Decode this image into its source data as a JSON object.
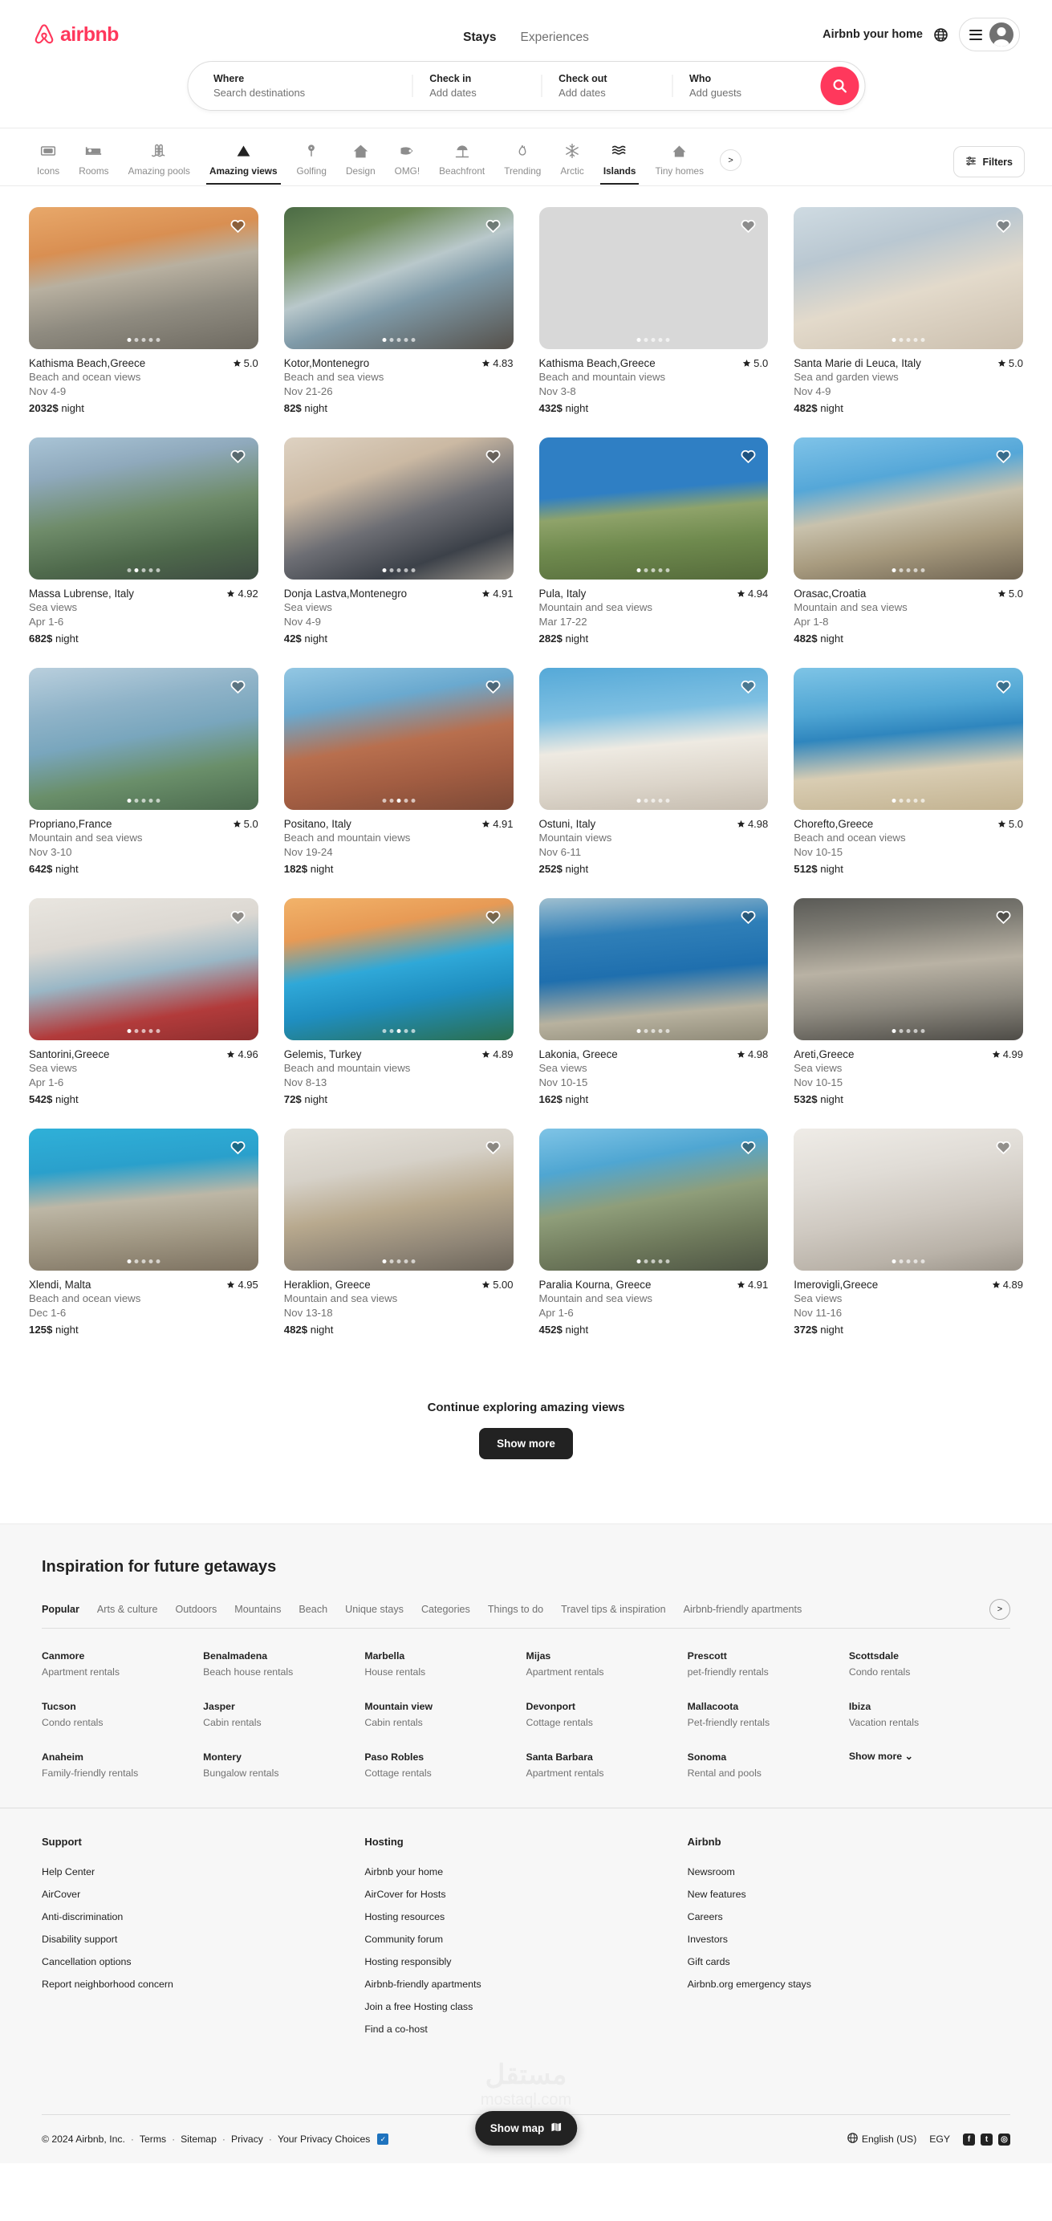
{
  "brand": {
    "name": "airbnb",
    "accent": "#FF385C"
  },
  "header": {
    "tabs": [
      {
        "label": "Stays",
        "active": true
      },
      {
        "label": "Experiences",
        "active": false
      }
    ],
    "host_link": "Airbnb your home",
    "globe_icon": "globe-icon",
    "menu_icon": "hamburger-icon",
    "avatar_icon": "user-avatar-icon"
  },
  "search": {
    "where_label": "Where",
    "where_placeholder": "Search destinations",
    "checkin_label": "Check in",
    "checkin_value": "Add dates",
    "checkout_label": "Check out",
    "checkout_value": "Add dates",
    "who_label": "Who",
    "who_value": "Add guests",
    "search_icon": "search-icon"
  },
  "categories": [
    {
      "label": "Icons",
      "icon": "icons-frame-icon",
      "active": false
    },
    {
      "label": "Rooms",
      "icon": "bed-icon",
      "active": false
    },
    {
      "label": "Amazing pools",
      "icon": "pool-icon",
      "active": false
    },
    {
      "label": "Amazing views",
      "icon": "mountain-icon",
      "active": true
    },
    {
      "label": "Golfing",
      "icon": "golf-icon",
      "active": false
    },
    {
      "label": "Design",
      "icon": "house-icon",
      "active": false
    },
    {
      "label": "OMG!",
      "icon": "omg-icon",
      "active": false
    },
    {
      "label": "Beachfront",
      "icon": "beach-umbrella-icon",
      "active": false
    },
    {
      "label": "Trending",
      "icon": "flame-icon",
      "active": false
    },
    {
      "label": "Arctic",
      "icon": "snowflake-icon",
      "active": false
    },
    {
      "label": "Islands",
      "icon": "waves-icon",
      "active": false
    },
    {
      "label": "Tiny homes",
      "icon": "tiny-house-icon",
      "active": false
    }
  ],
  "catbar": {
    "next_label": ">",
    "filters_label": "Filters",
    "filters_icon": "sliders-icon"
  },
  "listings": [
    {
      "title": "Kathisma Beach,Greece",
      "rating": "5.0",
      "sub": "Beach and ocean views",
      "dates": "Nov 4-9",
      "price": "2032$",
      "per": "night",
      "dots": 5,
      "active_dot": 0,
      "grad": "linear-gradient(170deg,#e8a86a 0%,#d98f52 28%,#b8b0a0 46%,#8f8b80 70%,#6e6a61 100%)"
    },
    {
      "title": "Kotor,Montenegro",
      "rating": "4.83",
      "sub": "Beach and sea views",
      "dates": "Nov 21-26",
      "price": "82$",
      "per": "night",
      "dots": 5,
      "active_dot": 0,
      "grad": "linear-gradient(160deg,#4b6b45 0%,#6d8a58 22%,#b9c8cb 46%,#7f9aa8 62%,#55504a 100%)"
    },
    {
      "title": "Kathisma Beach,Greece",
      "rating": "5.0",
      "sub": "Beach and mountain views",
      "dates": "Nov 3-8",
      "price": "432$",
      "per": "night",
      "dots": 5,
      "active_dot": 0,
      "grad": "linear-gradient(160deg,#c9d6dd 0%,#aebcc5 25%,#e7e0d4 55%,#cfc3b2 80%,#8f8madd 100%)"
    },
    {
      "title": "Santa Marie di Leuca, Italy",
      "rating": "5.0",
      "sub": "Sea and garden views",
      "dates": "Nov 4-9",
      "price": "482$",
      "per": "night",
      "dots": 5,
      "active_dot": 0,
      "grad": "linear-gradient(165deg,#cfdbe2 0%,#b9c7d1 30%,#e3dacb 58%,#cbbfae 100%)"
    },
    {
      "title": "Massa Lubrense, Italy",
      "rating": "4.92",
      "sub": "Sea views",
      "dates": "Apr 1-6",
      "price": "682$",
      "per": "night",
      "dots": 5,
      "active_dot": 1,
      "grad": "linear-gradient(170deg,#a9c4d6 0%,#8fa9bc 24%,#6f8c6a 52%,#4f6a4c 76%,#3e4c42 100%)"
    },
    {
      "title": "Donja Lastva,Montenegro",
      "rating": "4.91",
      "sub": "Sea views",
      "dates": "Nov 4-9",
      "price": "42$",
      "per": "night",
      "dots": 5,
      "active_dot": 0,
      "grad": "linear-gradient(160deg,#ded2c2 0%,#cbb9a3 30%,#6d6e74 55%,#3c4149 78%,#9b958c 100%)"
    },
    {
      "title": "Pula, Italy",
      "rating": "4.94",
      "sub": "Mountain and sea views",
      "dates": "Mar 17-22",
      "price": "282$",
      "per": "night",
      "dots": 5,
      "active_dot": 0,
      "grad": "linear-gradient(175deg,#2f7fc4 0%,#2f7fc4 38%,#8fa36a 52%,#6f8a4e 72%,#556b3b 100%)"
    },
    {
      "title": "Orasac,Croatia",
      "rating": "5.0",
      "sub": "Mountain and sea views",
      "dates": "Apr 1-8",
      "price": "482$",
      "per": "night",
      "dots": 5,
      "active_dot": 0,
      "grad": "linear-gradient(170deg,#7fc3e8 0%,#55a7d8 30%,#c9c2ad 50%,#a89b7f 72%,#6f6452 100%)"
    },
    {
      "title": "Propriano,France",
      "rating": "5.0",
      "sub": "Mountain and sea views",
      "dates": "Nov 3-10",
      "price": "642$",
      "per": "night",
      "dots": 5,
      "active_dot": 0,
      "grad": "linear-gradient(170deg,#b9cfdd 0%,#8fb3c8 28%,#79a6bd 48%,#6a8f6a 72%,#4c6b4f 100%)"
    },
    {
      "title": "Positano, Italy",
      "rating": "4.91",
      "sub": "Beach and mountain views",
      "dates": "Nov 19-24",
      "price": "182$",
      "per": "night",
      "dots": 5,
      "active_dot": 2,
      "grad": "linear-gradient(170deg,#93c7e3 0%,#6aa9cf 26%,#b86f4e 52%,#a25d42 74%,#7d4a37 100%)"
    },
    {
      "title": "Ostuni, Italy",
      "rating": "4.98",
      "sub": "Mountain views",
      "dates": "Nov 6-11",
      "price": "252$",
      "per": "night",
      "dots": 5,
      "active_dot": 0,
      "grad": "linear-gradient(175deg,#55a9d8 0%,#7fc0e2 32%,#eeeae2 54%,#dcd5ca 78%,#c6bdb0 100%)"
    },
    {
      "title": "Chorefto,Greece",
      "rating": "5.0",
      "sub": "Beach and ocean views",
      "dates": "Nov 10-15",
      "price": "512$",
      "per": "night",
      "dots": 5,
      "active_dot": 0,
      "grad": "linear-gradient(175deg,#7ec4e6 0%,#4fa5d3 30%,#2f86be 46%,#d9cdb3 70%,#c3b391 100%)"
    },
    {
      "title": "Santorini,Greece",
      "rating": "4.96",
      "sub": "Sea views",
      "dates": "Apr 1-6",
      "price": "542$",
      "per": "night",
      "dots": 5,
      "active_dot": 0,
      "grad": "linear-gradient(170deg,#e9e6e0 0%,#dcd8d2 30%,#9ab7c6 52%,#b23b3b 78%,#8e2f2f 100%)"
    },
    {
      "title": "Gelemis, Turkey",
      "rating": "4.89",
      "sub": "Beach and mountain views",
      "dates": "Nov 8-13",
      "price": "72$",
      "per": "night",
      "dots": 5,
      "active_dot": 2,
      "grad": "linear-gradient(170deg,#f2b36a 0%,#e79a55 24%,#2fa8d8 48%,#1f8ec0 68%,#2b6f4e 100%)"
    },
    {
      "title": "Lakonia, Greece",
      "rating": "4.98",
      "sub": "Sea views",
      "dates": "Nov 10-15",
      "price": "162$",
      "per": "night",
      "dots": 5,
      "active_dot": 0,
      "grad": "linear-gradient(175deg,#9fbfcf 0%,#2f7fb8 26%,#1f6fae 52%,#b8b29f 78%,#8f8a78 100%)"
    },
    {
      "title": "Areti,Greece",
      "rating": "4.99",
      "sub": "Sea views",
      "dates": "Nov 10-15",
      "price": "532$",
      "per": "night",
      "dots": 5,
      "active_dot": 0,
      "grad": "linear-gradient(175deg,#5a5a56 0%,#7e7c74 22%,#b9b2a4 48%,#8e8a80 72%,#4e4c47 100%)"
    },
    {
      "title": "Xlendi, Malta",
      "rating": "4.95",
      "sub": "Beach and ocean views",
      "dates": "Dec 1-6",
      "price": "125$",
      "per": "night",
      "dots": 5,
      "active_dot": 0,
      "grad": "linear-gradient(175deg,#2fb0d8 0%,#2aa0cc 28%,#bdb7a6 50%,#a39a86 72%,#7d7261 100%)"
    },
    {
      "title": "Heraklion, Greece",
      "rating": "5.00",
      "sub": "Mountain and sea views",
      "dates": "Nov 13-18",
      "price": "482$",
      "per": "night",
      "dots": 5,
      "active_dot": 0,
      "grad": "linear-gradient(170deg,#e7e3dc 0%,#d6d1c8 30%,#b8a98e 55%,#8f8576 80%,#6c655a 100%)"
    },
    {
      "title": "Paralia Kourna, Greece",
      "rating": "4.91",
      "sub": "Mountain and sea views",
      "dates": "Apr 1-6",
      "price": "452$",
      "per": "night",
      "dots": 5,
      "active_dot": 0,
      "grad": "linear-gradient(170deg,#7fc4e6 0%,#4fa6d2 26%,#8f9e7a 50%,#6f7a5c 74%,#4e5544 100%)"
    },
    {
      "title": "Imerovigli,Greece",
      "rating": "4.89",
      "sub": "Sea views",
      "dates": "Nov 11-16",
      "price": "372$",
      "per": "night",
      "dots": 5,
      "active_dot": 0,
      "grad": "linear-gradient(170deg,#efece7 0%,#e0dcd6 32%,#cfc9c1 58%,#b9b2a8 82%,#9b948a 100%)"
    }
  ],
  "continue": {
    "title": "Continue exploring amazing views",
    "button": "Show more"
  },
  "inspiration": {
    "title": "Inspiration for future getaways",
    "tabs": [
      {
        "label": "Popular",
        "active": true
      },
      {
        "label": "Arts & culture",
        "active": false
      },
      {
        "label": "Outdoors",
        "active": false
      },
      {
        "label": "Mountains",
        "active": false
      },
      {
        "label": "Beach",
        "active": false
      },
      {
        "label": "Unique stays",
        "active": false
      },
      {
        "label": "Categories",
        "active": false
      },
      {
        "label": "Things to do",
        "active": false
      },
      {
        "label": "Travel tips & inspiration",
        "active": false
      },
      {
        "label": "Airbnb-friendly apartments",
        "active": false
      }
    ],
    "next_label": ">",
    "cells": [
      {
        "city": "Canmore",
        "kind": "Apartment rentals"
      },
      {
        "city": "Benalmadena",
        "kind": "Beach house rentals"
      },
      {
        "city": "Marbella",
        "kind": "House rentals"
      },
      {
        "city": "Mijas",
        "kind": "Apartment rentals"
      },
      {
        "city": "Prescott",
        "kind": "pet-friendly rentals"
      },
      {
        "city": "Scottsdale",
        "kind": "Condo rentals"
      },
      {
        "city": "Tucson",
        "kind": "Condo rentals"
      },
      {
        "city": "Jasper",
        "kind": "Cabin rentals"
      },
      {
        "city": "Mountain view",
        "kind": "Cabin rentals"
      },
      {
        "city": "Devonport",
        "kind": "Cottage rentals"
      },
      {
        "city": "Mallacoota",
        "kind": "Pet-friendly rentals"
      },
      {
        "city": "Ibiza",
        "kind": "Vacation rentals"
      },
      {
        "city": "Anaheim",
        "kind": "Family-friendly rentals"
      },
      {
        "city": "Montery",
        "kind": "Bungalow rentals"
      },
      {
        "city": "Paso Robles",
        "kind": "Cottage rentals"
      },
      {
        "city": "Santa Barbara",
        "kind": "Apartment rentals"
      },
      {
        "city": "Sonoma",
        "kind": "Rental and pools"
      }
    ],
    "show_more": "Show more ⌄"
  },
  "footer": {
    "columns": [
      {
        "title": "Support",
        "links": [
          "Help Center",
          "AirCover",
          "Anti-discrimination",
          "Disability support",
          "Cancellation options",
          "Report neighborhood concern"
        ]
      },
      {
        "title": "Hosting",
        "links": [
          "Airbnb your home",
          "AirCover for Hosts",
          "Hosting resources",
          "Community forum",
          "Hosting responsibly",
          "Airbnb-friendly apartments",
          "Join a free Hosting class",
          "Find a co-host"
        ]
      },
      {
        "title": "Airbnb",
        "links": [
          "Newsroom",
          "New features",
          "Careers",
          "Investors",
          "Gift cards",
          "Airbnb.org emergency stays"
        ]
      }
    ],
    "watermark_ar": "مستقل",
    "watermark_en": "mostaql.com",
    "copyright": "© 2024 Airbnb, Inc.",
    "legal_links": [
      "Terms",
      "Sitemap",
      "Privacy",
      "Your Privacy Choices"
    ],
    "language": "English (US)",
    "currency": "EGY",
    "socials": [
      "facebook-icon",
      "twitter-icon",
      "instagram-icon"
    ],
    "globe_icon": "globe-icon"
  },
  "showmap": {
    "label": "Show map",
    "icon": "map-icon"
  }
}
